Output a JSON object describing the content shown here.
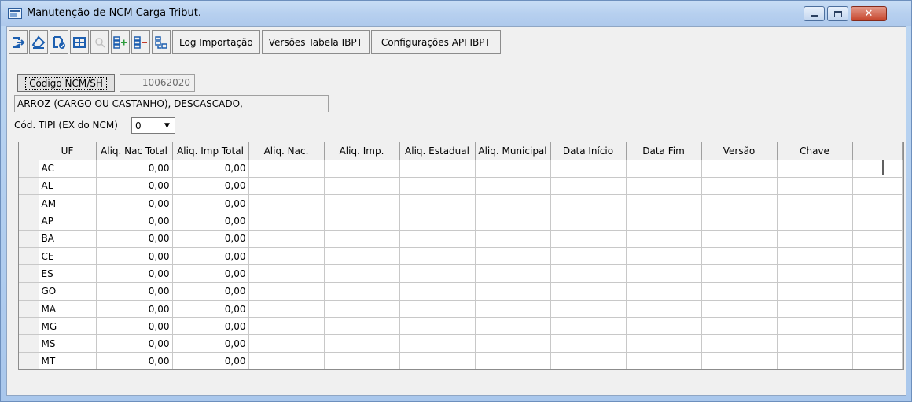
{
  "window": {
    "title": "Manutenção de NCM Carga Tribut."
  },
  "toolbar": {
    "log_label": "Log Importação",
    "versions_label": "Versões Tabela IBPT",
    "config_label": "Configurações API IBPT"
  },
  "form": {
    "code_button_label": "Código NCM/SH",
    "code_value": "10062020",
    "description": "ARROZ (CARGO OU CASTANHO), DESCASCADO,",
    "tipi_label": "Cód. TIPI (EX do NCM)",
    "tipi_value": "0"
  },
  "table": {
    "columns": [
      "UF",
      "Aliq. Nac Total",
      "Aliq. Imp Total",
      "Aliq. Nac.",
      "Aliq. Imp.",
      "Aliq. Estadual",
      "Aliq. Municipal",
      "Data Início",
      "Data Fim",
      "Versão",
      "Chave"
    ],
    "rows": [
      [
        "AC",
        "0,00",
        "0,00"
      ],
      [
        "AL",
        "0,00",
        "0,00"
      ],
      [
        "AM",
        "0,00",
        "0,00"
      ],
      [
        "AP",
        "0,00",
        "0,00"
      ],
      [
        "BA",
        "0,00",
        "0,00"
      ],
      [
        "CE",
        "0,00",
        "0,00"
      ],
      [
        "ES",
        "0,00",
        "0,00"
      ],
      [
        "GO",
        "0,00",
        "0,00"
      ],
      [
        "MA",
        "0,00",
        "0,00"
      ],
      [
        "MG",
        "0,00",
        "0,00"
      ],
      [
        "MS",
        "0,00",
        "0,00"
      ],
      [
        "MT",
        "0,00",
        "0,00"
      ]
    ]
  }
}
